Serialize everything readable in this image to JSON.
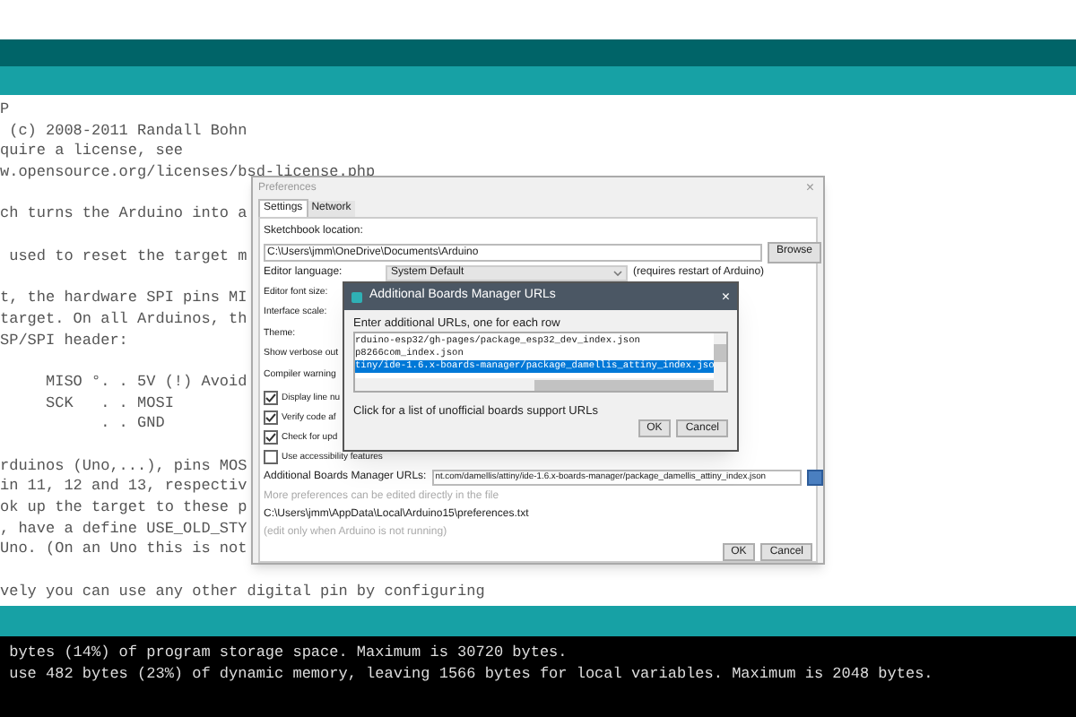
{
  "code_paragraphs": [
    [
      "P",
      " (c) 2008-2011 Randall Bohn",
      "quire a license, see",
      "w.opensource.org/licenses/bsd-license.php"
    ],
    [
      "ch turns the Arduino into a"
    ],
    [
      " used to reset the target m"
    ],
    [
      "t, the hardware SPI pins MI",
      "target. On all Arduinos, th",
      "SP/SPI header:"
    ],
    [
      "     MISO °. . 5V (!) Avoid",
      "     SCK   . . MOSI",
      "           . . GND"
    ],
    [
      "rduinos (Uno,...), pins MOS",
      "in 11, 12 and 13, respectiv",
      "ok up the target to these p",
      ", have a define USE_OLD_STY",
      "Uno. (On an Uno this is not"
    ],
    [
      "vely you can use any other digital pin by configuring"
    ]
  ],
  "console_lines": [
    " bytes (14%) of program storage space. Maximum is 30720 bytes.",
    " use 482 bytes (23%) of dynamic memory, leaving 1566 bytes for local variables. Maximum is 2048 bytes."
  ],
  "preferences": {
    "title": "Preferences",
    "tabs": [
      {
        "label": "Settings",
        "selected": true
      },
      {
        "label": "Network",
        "selected": false
      }
    ],
    "sketchbook_label": "Sketchbook location:",
    "sketchbook_value": "C:\\Users\\jmm\\OneDrive\\Documents\\Arduino",
    "browse": "Browse",
    "language_label": "Editor language:",
    "language_value": "System Default",
    "language_note": "(requires restart of Arduino)",
    "labels": [
      "Editor font size:",
      "Interface scale:",
      "Theme:",
      "Show verbose out",
      "Compiler warning"
    ],
    "checkboxes": [
      {
        "label": "Display line nu",
        "checked": true
      },
      {
        "label": "Verify code af",
        "checked": true
      },
      {
        "label": "Check for upd",
        "checked": true
      },
      {
        "label": "Use accessibility features",
        "checked": false
      }
    ],
    "urls_label": "Additional Boards Manager URLs:",
    "urls_value": "nt.com/damellis/attiny/ide-1.6.x-boards-manager/package_damellis_attiny_index.json",
    "more_note": "More preferences can be edited directly in the file",
    "file_path": "C:\\Users\\jmm\\AppData\\Local\\Arduino15\\preferences.txt",
    "edit_note": "(edit only when Arduino is not running)",
    "buttons": [
      "OK",
      "Cancel"
    ]
  },
  "urls_dialog": {
    "title": "Additional Boards Manager URLs",
    "close": "×",
    "prompt": "Enter additional URLs, one for each row",
    "rows": [
      {
        "text": "rduino-esp32/gh-pages/package_esp32_dev_index.json",
        "selected": false
      },
      {
        "text": "p8266com_index.json",
        "selected": false
      },
      {
        "text": "tiny/ide-1.6.x-boards-manager/package_damellis_attiny_index.jso",
        "selected": true
      }
    ],
    "link": "Click for a list of unofficial boards support URLs",
    "buttons": [
      "OK",
      "Cancel"
    ]
  }
}
